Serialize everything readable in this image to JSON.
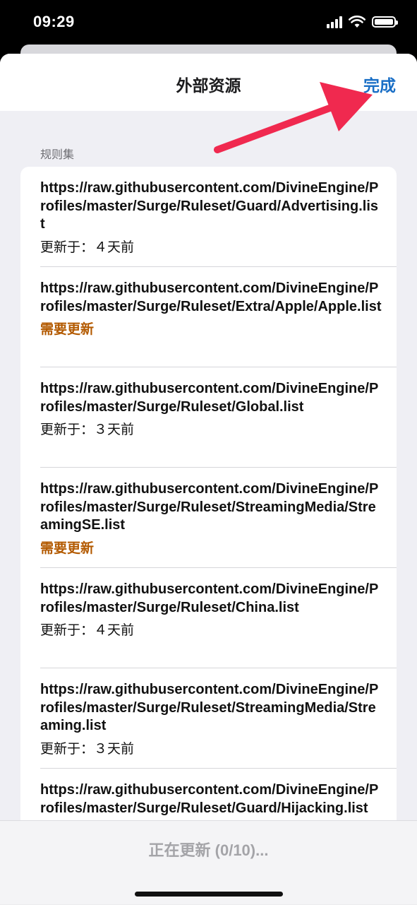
{
  "status_bar": {
    "time": "09:29"
  },
  "nav": {
    "title": "外部资源",
    "done_label": "完成"
  },
  "section": {
    "header": "规则集"
  },
  "rules": [
    {
      "url": "https://raw.githubusercontent.com/DivineEngine/Profiles/master/Surge/Ruleset/Guard/Advertising.list",
      "status": "更新于：４天前",
      "needs_update": false
    },
    {
      "url": "https://raw.githubusercontent.com/DivineEngine/Profiles/master/Surge/Ruleset/Extra/Apple/Apple.list",
      "status": "需要更新",
      "needs_update": true
    },
    {
      "url": "https://raw.githubusercontent.com/DivineEngine/Profiles/master/Surge/Ruleset/Global.list",
      "status": "更新于：３天前",
      "needs_update": false
    },
    {
      "url": "https://raw.githubusercontent.com/DivineEngine/Profiles/master/Surge/Ruleset/StreamingMedia/StreamingSE.list",
      "status": "需要更新",
      "needs_update": true
    },
    {
      "url": "https://raw.githubusercontent.com/DivineEngine/Profiles/master/Surge/Ruleset/China.list",
      "status": "更新于：４天前",
      "needs_update": false
    },
    {
      "url": "https://raw.githubusercontent.com/DivineEngine/Profiles/master/Surge/Ruleset/StreamingMedia/Streaming.list",
      "status": "更新于：３天前",
      "needs_update": false
    },
    {
      "url": "https://raw.githubusercontent.com/DivineEngine/Profiles/master/Surge/Ruleset/Guard/Hijacking.list",
      "status": "",
      "needs_update": false
    }
  ],
  "bottom": {
    "progress_label": "正在更新 (0/10)..."
  },
  "colors": {
    "accent": "#1a6fc6",
    "needs_update": "#b35a00",
    "arrow": "#f0294f"
  }
}
